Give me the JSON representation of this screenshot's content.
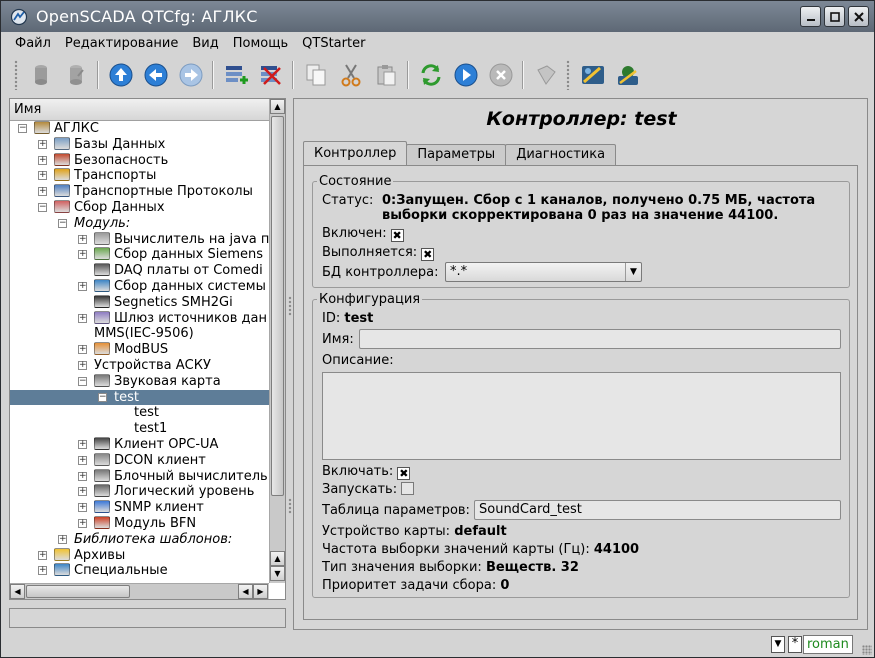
{
  "window": {
    "title": "OpenSCADA QTCfg: АГЛКС"
  },
  "menu": [
    {
      "label": "Файл"
    },
    {
      "label": "Редактирование"
    },
    {
      "label": "Вид"
    },
    {
      "label": "Помощь"
    },
    {
      "label": "QTStarter"
    }
  ],
  "toolbar": {
    "icons": [
      "db-load-icon",
      "db-save-icon",
      "up-icon",
      "back-icon",
      "forward-icon",
      "add-item-icon",
      "delete-item-icon",
      "copy-icon",
      "cut-icon",
      "paste-icon",
      "refresh-icon",
      "start-icon",
      "stop-icon",
      "info-icon",
      "qtcfg-icon",
      "vision-icon"
    ]
  },
  "tree": {
    "header": "Имя",
    "items": [
      {
        "label": "АГЛКС",
        "italic": false
      },
      {
        "label": "Базы Данных",
        "italic": false
      },
      {
        "label": "Безопасность",
        "italic": false
      },
      {
        "label": "Транспорты",
        "italic": false
      },
      {
        "label": "Транспортные Протоколы",
        "italic": false
      },
      {
        "label": "Сбор Данных",
        "italic": false
      },
      {
        "label": "Модуль:",
        "italic": true
      },
      {
        "label": "Вычислитель на java п",
        "italic": false
      },
      {
        "label": "Сбор данных Siemens",
        "italic": false
      },
      {
        "label": "DAQ платы от Comedi",
        "italic": false
      },
      {
        "label": "Сбор данных системы",
        "italic": false
      },
      {
        "label": "Segnetics SMH2Gi",
        "italic": false
      },
      {
        "label": "Шлюз источников дан",
        "italic": false
      },
      {
        "label": "MMS(IEC-9506)",
        "italic": false
      },
      {
        "label": "ModBUS",
        "italic": false
      },
      {
        "label": "Устройства АСКУ",
        "italic": false
      },
      {
        "label": "Звуковая карта",
        "italic": false
      },
      {
        "label": "test",
        "italic": false
      },
      {
        "label": "test",
        "italic": false
      },
      {
        "label": "test1",
        "italic": false
      },
      {
        "label": "Клиент OPC-UA",
        "italic": false
      },
      {
        "label": "DCON клиент",
        "italic": false
      },
      {
        "label": "Блочный вычислитель",
        "italic": false
      },
      {
        "label": "Логический уровень",
        "italic": false
      },
      {
        "label": "SNMP клиент",
        "italic": false
      },
      {
        "label": "Модуль BFN",
        "italic": false
      },
      {
        "label": "Библиотека шаблонов:",
        "italic": true
      },
      {
        "label": "Архивы",
        "italic": false
      },
      {
        "label": "Специальные",
        "italic": false
      }
    ]
  },
  "page": {
    "title": "Контроллер: test",
    "tabs": [
      {
        "label": "Контроллер",
        "active": true
      },
      {
        "label": "Параметры",
        "active": false
      },
      {
        "label": "Диагностика",
        "active": false
      }
    ],
    "state": {
      "legend": "Состояние",
      "status_label": "Статус:",
      "status_line1": "0:Запущен. Сбор с 1 каналов, получено 0.75 МБ, частота",
      "status_line2": "выборки скорректирована 0 раз на значение 44100.",
      "enabled_label": "Включен:",
      "enabled": true,
      "running_label": "Выполняется:",
      "running": true,
      "db_label": "БД контроллера:",
      "db_value": "*.*"
    },
    "config": {
      "legend": "Конфигурация",
      "id_label": "ID:",
      "id_value": "test",
      "name_label": "Имя:",
      "name_value": "",
      "descr_label": "Описание:",
      "descr_value": "",
      "to_enable_label": "Включать:",
      "to_enable": true,
      "to_start_label": "Запускать:",
      "to_start": false,
      "params_table_label": "Таблица параметров:",
      "params_table_value": "SoundCard_test",
      "card_label": "Устройство карты:",
      "card_value": "default",
      "samplerate_label": "Частота выборки значений карты (Гц):",
      "samplerate_value": "44100",
      "sampletype_label": "Тип значения выборки:",
      "sampletype_value": "Веществ. 32",
      "priority_label": "Приоритет задачи сбора:",
      "priority_value": "0"
    }
  },
  "statusbar": {
    "user": "roman",
    "modified_mark": "*"
  }
}
